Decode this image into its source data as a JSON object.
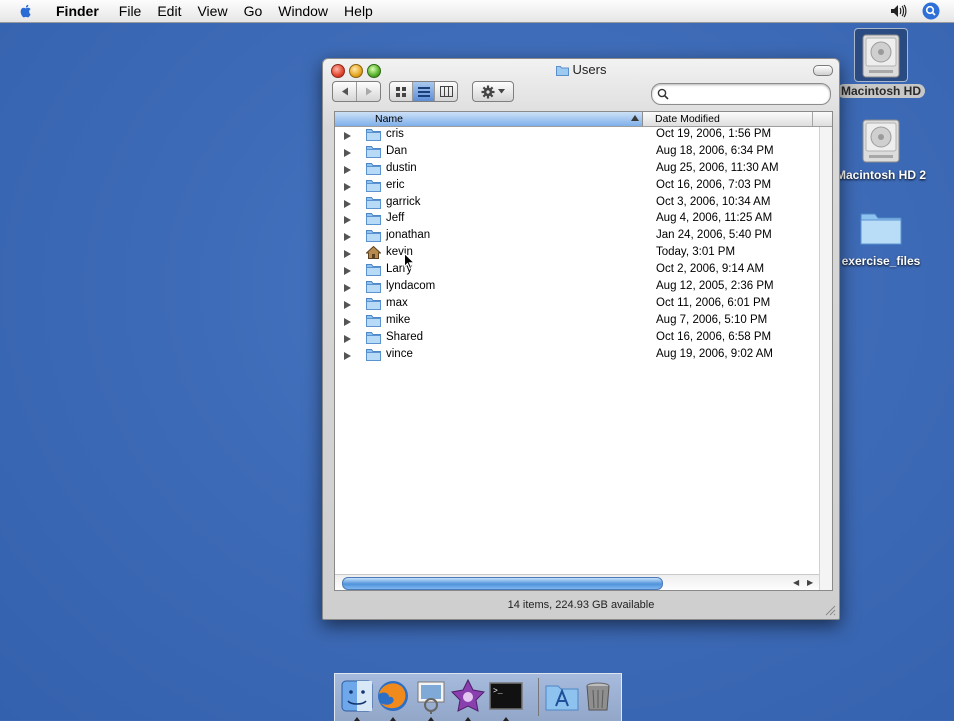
{
  "menubar": {
    "app_name": "Finder",
    "menus": [
      "File",
      "Edit",
      "View",
      "Go",
      "Window",
      "Help"
    ],
    "status_icons": [
      "volume-icon",
      "spotlight-icon"
    ]
  },
  "desktop_icons": [
    {
      "label": "Macintosh HD",
      "icon": "hard-drive-icon",
      "selected": true
    },
    {
      "label": "Macintosh HD 2",
      "icon": "hard-drive-icon",
      "selected": false
    },
    {
      "label": "exercise_files",
      "icon": "folder-icon",
      "selected": false
    }
  ],
  "window": {
    "title": "Users",
    "search_placeholder": "",
    "columns": {
      "name": "Name",
      "date": "Date Modified"
    },
    "sort_column": "Name",
    "view_mode": "list",
    "items": [
      {
        "name": "cris",
        "date": "Oct 19, 2006, 1:56 PM",
        "icon": "folder-icon"
      },
      {
        "name": "Dan",
        "date": "Aug 18, 2006, 6:34 PM",
        "icon": "folder-icon"
      },
      {
        "name": "dustin",
        "date": "Aug 25, 2006, 11:30 AM",
        "icon": "folder-icon"
      },
      {
        "name": "eric",
        "date": "Oct 16, 2006, 7:03 PM",
        "icon": "folder-icon"
      },
      {
        "name": "garrick",
        "date": "Oct 3, 2006, 10:34 AM",
        "icon": "folder-icon"
      },
      {
        "name": "Jeff",
        "date": "Aug 4, 2006, 11:25 AM",
        "icon": "folder-icon"
      },
      {
        "name": "jonathan",
        "date": "Jan 24, 2006, 5:40 PM",
        "icon": "folder-icon"
      },
      {
        "name": "kevin",
        "date": "Today, 3:01 PM",
        "icon": "home-icon"
      },
      {
        "name": "Larry",
        "date": "Oct 2, 2006, 9:14 AM",
        "icon": "folder-icon"
      },
      {
        "name": "lyndacom",
        "date": "Aug 12, 2005, 2:36 PM",
        "icon": "folder-icon"
      },
      {
        "name": "max",
        "date": "Oct 11, 2006, 6:01 PM",
        "icon": "folder-icon"
      },
      {
        "name": "mike",
        "date": "Aug 7, 2006, 5:10 PM",
        "icon": "folder-icon"
      },
      {
        "name": "Shared",
        "date": "Oct 16, 2006, 6:58 PM",
        "icon": "folder-icon"
      },
      {
        "name": "vince",
        "date": "Aug 19, 2006, 9:02 AM",
        "icon": "folder-icon"
      }
    ],
    "status_text": "14 items, 224.93 GB available"
  },
  "dock": {
    "apps": [
      "finder-icon",
      "firefox-icon",
      "preview-icon",
      "dvd-studio-icon",
      "terminal-icon"
    ],
    "others": [
      "applications-folder-icon",
      "trash-icon"
    ]
  },
  "colors": {
    "desktop": "#3c68b3",
    "selection_blue": "#7fb0ea",
    "window_chrome": "#d9d9d9"
  }
}
